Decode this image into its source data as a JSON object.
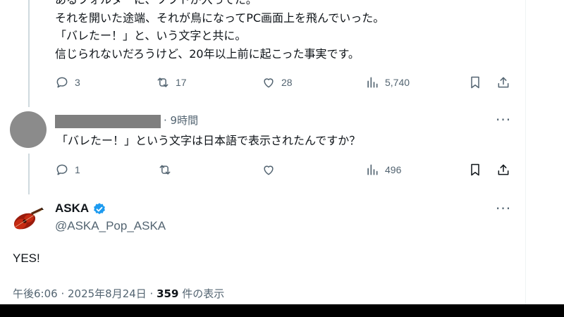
{
  "parent_tweet": {
    "text_lines": [
      "あるフォルダーに、ソフトが入ってた。",
      "それを開いた途端、それが鳥になってPC画面上を飛んでいった。",
      "「バレたー！」と、いう文字と共に。",
      "信じられないだろうけど、20年以上前に起こった事実です。"
    ],
    "replies": "3",
    "reposts": "17",
    "likes": "28",
    "views": "5,740"
  },
  "reply_tweet": {
    "time": "· 9時間",
    "text": "「バレたー！」という文字は日本語で表示されたんですか？",
    "replies": "1",
    "views": "496"
  },
  "main_tweet": {
    "author_name": "ASKA",
    "handle": "@ASKA_Pop_ASKA",
    "text": "YES!",
    "time": "午後6:06 · 2025年8月24日 · ",
    "view_count": "359",
    "view_suffix": " 件の表示"
  },
  "more_label": "···",
  "colors": {
    "text": "#0f1419",
    "secondary": "#536471",
    "verified": "#1d9bf0",
    "thread_line": "#cfd9de"
  },
  "icons": [
    "reply-icon",
    "repost-icon",
    "like-icon",
    "views-icon",
    "bookmark-icon",
    "share-icon",
    "verified-badge-icon"
  ]
}
